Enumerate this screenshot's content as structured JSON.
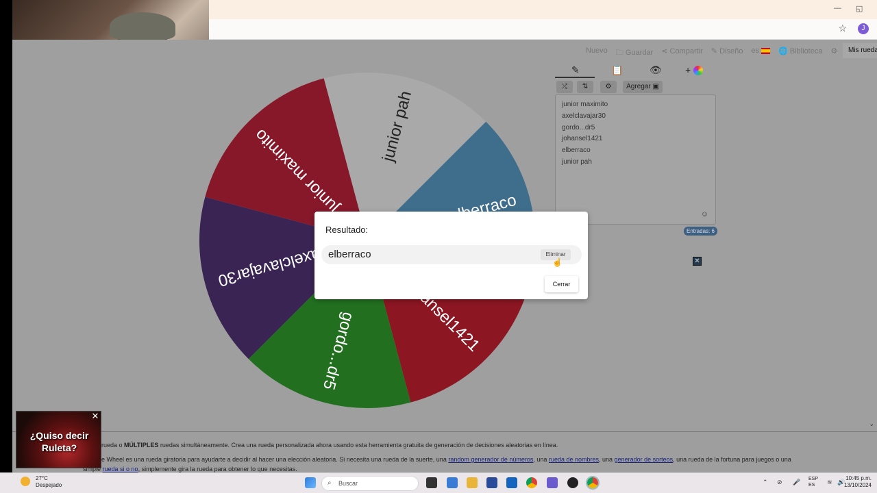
{
  "browser": {
    "profile_initial": "J",
    "minimize": "—",
    "restore": "◱"
  },
  "top_menu": {
    "items": [
      "Nuevo",
      "Guardar",
      "Compartir",
      "Diseño",
      "es",
      "Biblioteca"
    ],
    "my_wheels": "Mis ruedas"
  },
  "toolbar": {
    "add_label": "Agregar"
  },
  "entries": {
    "list": [
      "junior maximito",
      "axelclavajar30",
      "gordo...dr5",
      "johansel1421",
      "elberraco",
      "junior pah"
    ],
    "count_label": "Entradas: 6"
  },
  "wheel": {
    "segments": [
      {
        "label": "junior pah",
        "color": "#a9a9a9"
      },
      {
        "label": "elberraco",
        "color": "#3f6e8d"
      },
      {
        "label": "johansel1421",
        "color": "#8c1622"
      },
      {
        "label": "gordo...dr5",
        "color": "#22701f"
      },
      {
        "label": "axelclavajar30",
        "color": "#3a2454"
      },
      {
        "label": "junior maximito",
        "color": "#86182a"
      }
    ]
  },
  "modal": {
    "title": "Resultado:",
    "result": "elberraco",
    "remove_label": "Eliminar",
    "close_label": "Cerrar"
  },
  "bottom": {
    "line1_pre": "rueda o",
    "line1_bold": "MÚLTIPLES",
    "line1_post": "ruedas simultáneamente. Crea una rueda personalizada ahora usando esta herramienta gratuita de generación de decisiones aleatorias en línea.",
    "line2_pre": "e Wheel es una rueda giratoria para ayudarte a decidir al hacer una elección aleatoria. Si necesita una rueda de la suerte, una",
    "link1": "random generador de números",
    "sep1": ", una",
    "link2": "rueda de nombres",
    "sep2": ", una",
    "link3": "generador de sorteos",
    "line2_post": ", una rueda de la fortuna para juegos o una",
    "line3_pre": "simple",
    "link4": "rueda si o no",
    "line3_post": ", simplemente gira la rueda para obtener lo que necesitas."
  },
  "ad": {
    "text": "¿Quiso decir Ruleta?",
    "close": "✕"
  },
  "taskbar": {
    "temperature": "27°C",
    "condition": "Despejado",
    "search_placeholder": "Buscar",
    "lang1": "ESP",
    "lang2": "ES",
    "time": "10:45 p.m.",
    "date": "13/10/2024"
  }
}
